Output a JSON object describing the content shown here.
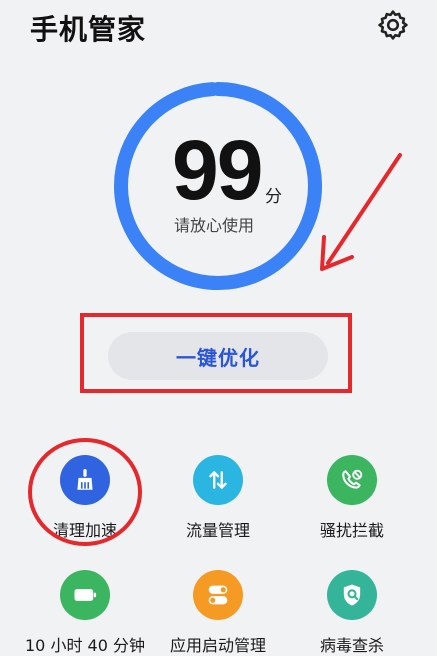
{
  "header": {
    "title": "手机管家",
    "settings_icon": "gear-icon"
  },
  "score": {
    "value": "99",
    "unit": "分",
    "status": "请放心使用",
    "progress": 0.99
  },
  "optimize": {
    "label": "一键优化"
  },
  "colors": {
    "accent": "#2a55d8",
    "ring": "#3b82f6",
    "highlight": "#e5282c",
    "clean": "#2f63e0",
    "traffic": "#2ab6e0",
    "harass": "#3cb561",
    "battery": "#3cb561",
    "startup": "#f59a23",
    "virus": "#34b59a"
  },
  "tiles": [
    {
      "label": "清理加速",
      "icon": "broom-icon"
    },
    {
      "label": "流量管理",
      "icon": "data-arrows-icon"
    },
    {
      "label": "骚扰拦截",
      "icon": "phone-block-icon"
    },
    {
      "label": "10 小时 40 分钟",
      "icon": "battery-icon"
    },
    {
      "label": "应用启动管理",
      "icon": "toggle-icon"
    },
    {
      "label": "病毒查杀",
      "icon": "shield-search-icon"
    }
  ]
}
